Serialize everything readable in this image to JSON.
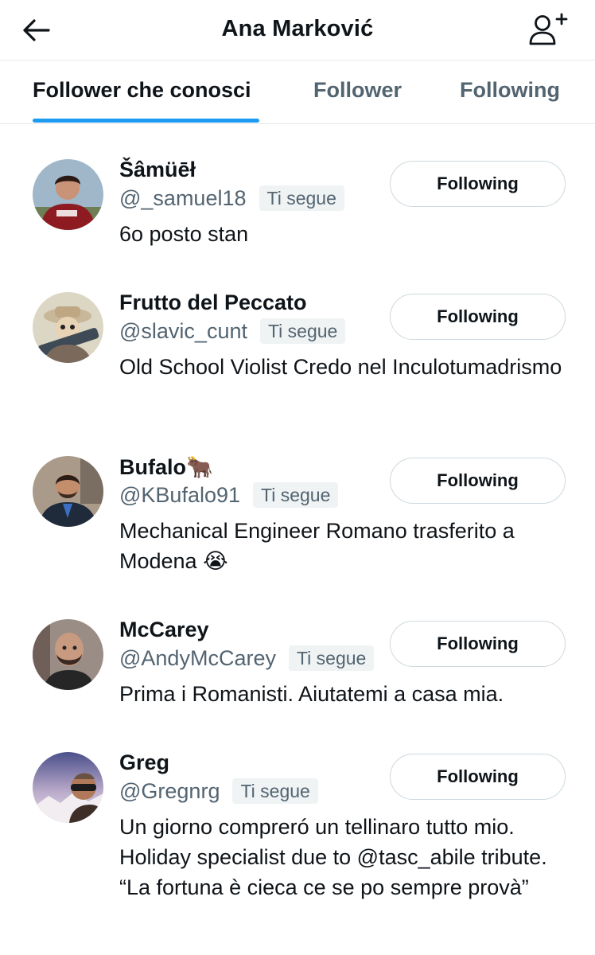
{
  "header": {
    "title": "Ana Marković",
    "back_icon": "arrow-left-icon",
    "add_user_icon": "person-add-icon"
  },
  "tabs": [
    {
      "label": "Follower che conosci",
      "active": true
    },
    {
      "label": "Follower",
      "active": false
    },
    {
      "label": "Following",
      "active": false
    }
  ],
  "accent_color": "#1d9bf0",
  "users": [
    {
      "name": "Šâmüēł",
      "handle": "@_samuel18",
      "badge": "Ti segue",
      "bio": "6o posto stan",
      "button": "Following"
    },
    {
      "name": "Frutto del Peccato",
      "handle": "@slavic_cunt",
      "badge": "Ti segue",
      "bio": "Old School Violist Credo nel Inculotumadrismo",
      "button": "Following"
    },
    {
      "name": "Bufalo🐂",
      "handle": "@KBufalo91",
      "badge": "Ti segue",
      "bio": "Mechanical Engineer Romano trasferito a Modena 😭",
      "button": "Following"
    },
    {
      "name": "McCarey",
      "handle": "@AndyMcCarey",
      "badge": "Ti segue",
      "bio": "Prima i Romanisti. Aiutatemi a casa mia.",
      "button": "Following"
    },
    {
      "name": "Greg",
      "handle": "@Gregnrg",
      "badge": "Ti segue",
      "bio": "Un giorno compreró un tellinaro tutto mio. Holiday specialist due to @tasc_abile tribute. “La fortuna è cieca ce se po sempre provà”",
      "button": "Following"
    }
  ]
}
